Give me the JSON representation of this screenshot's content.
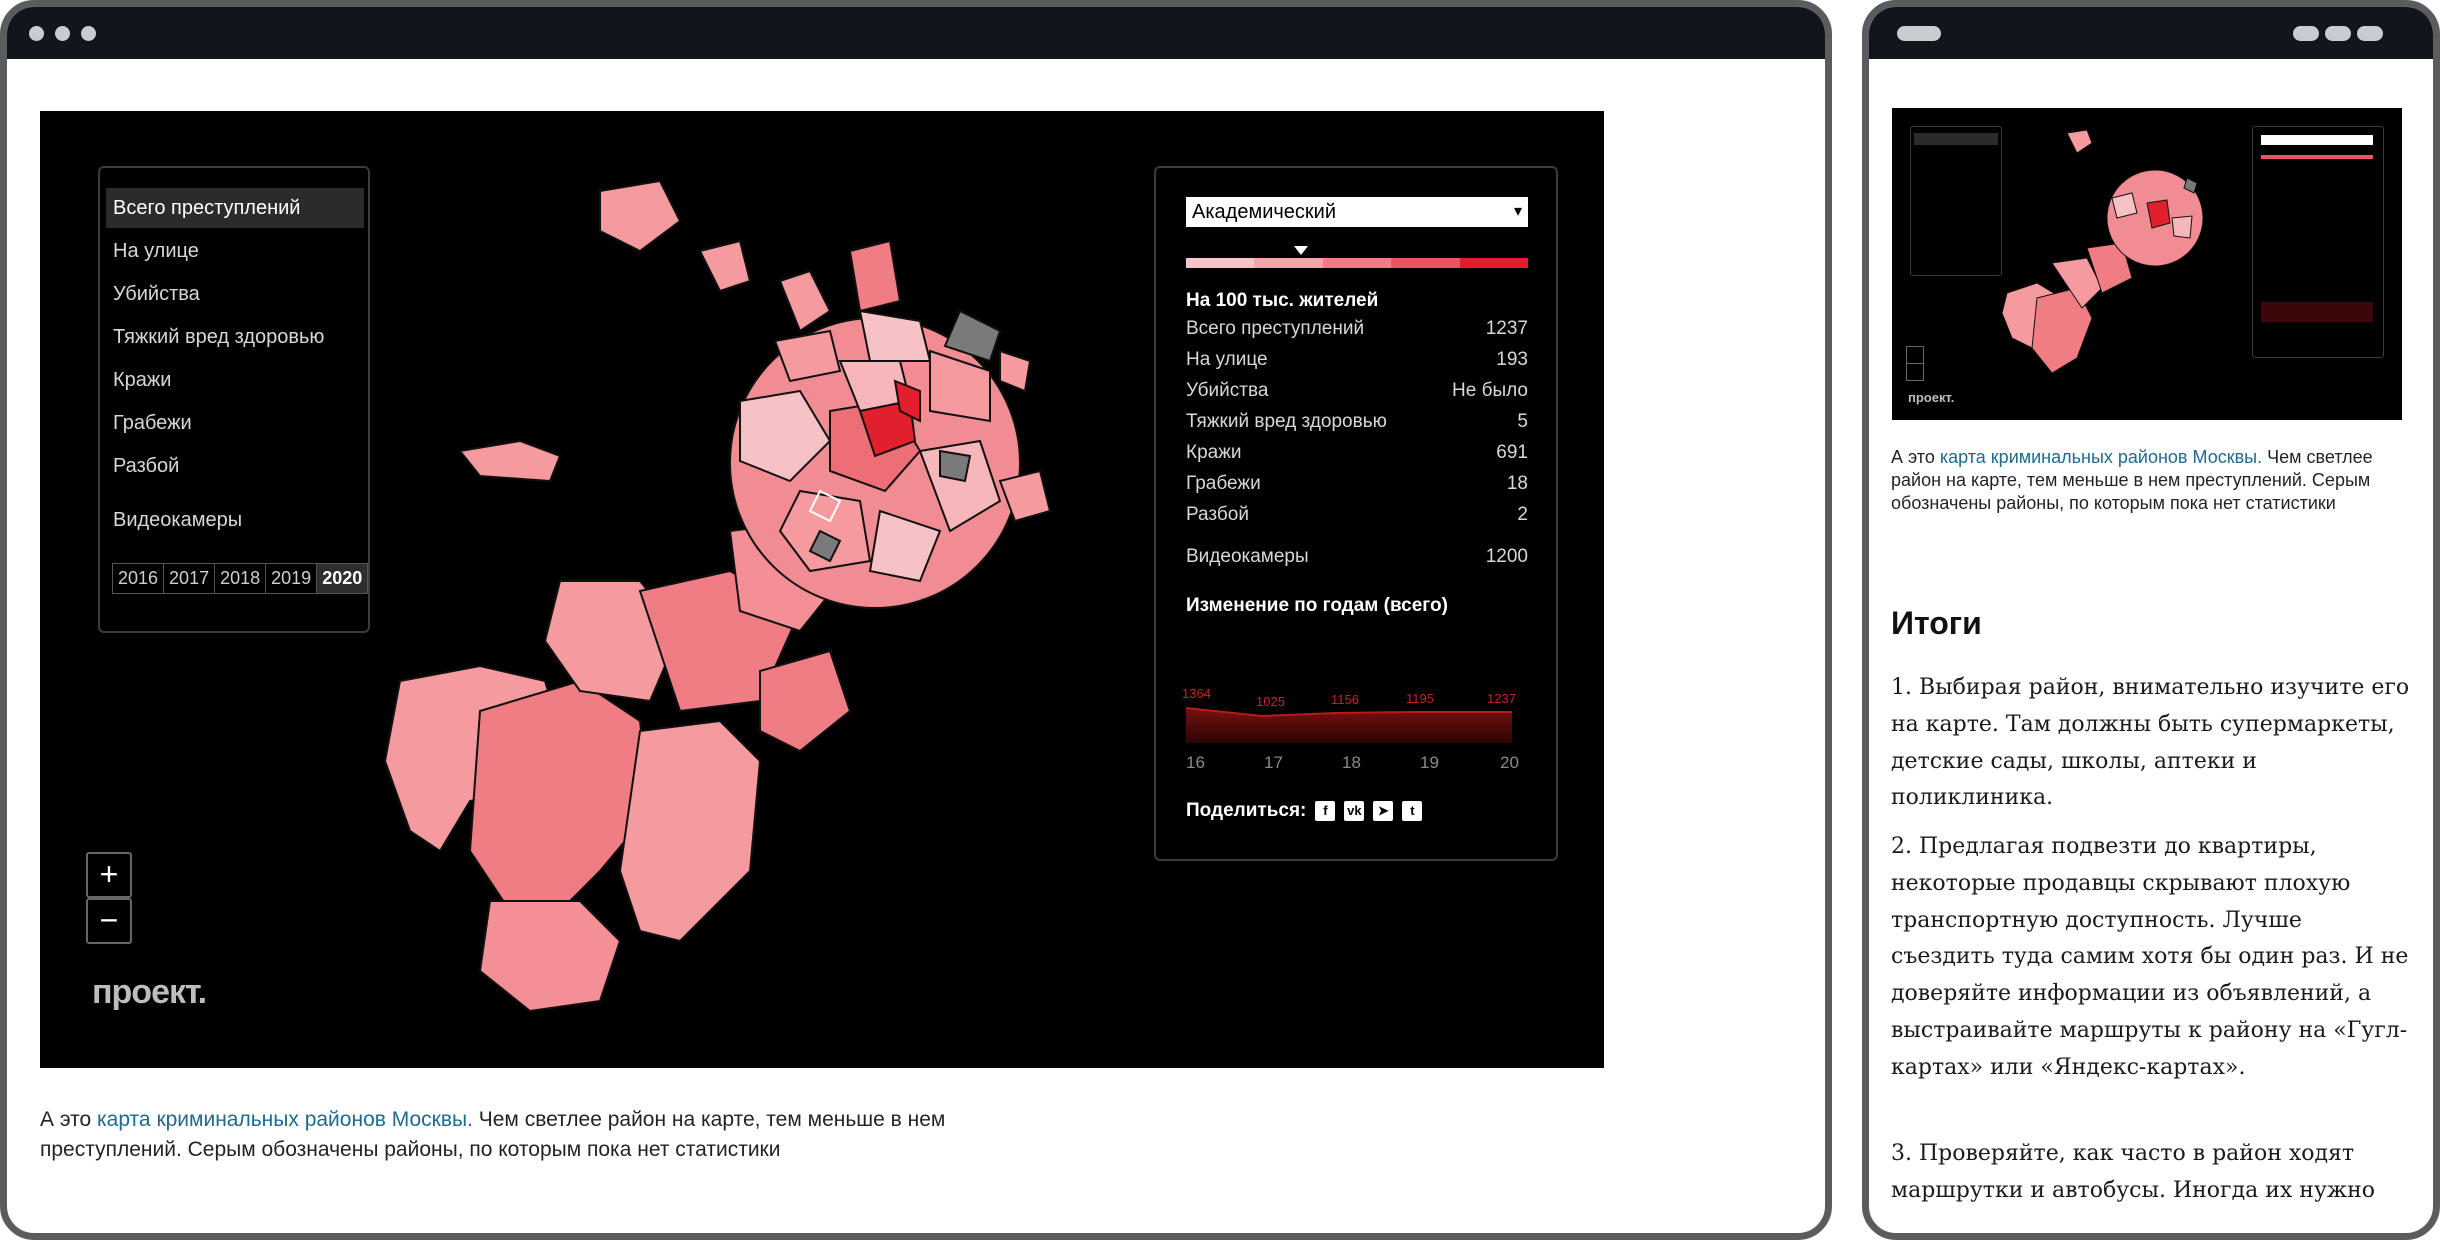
{
  "desktop_map": {
    "categories": [
      "Всего преступлений",
      "На улице",
      "Убийства",
      "Тяжкий вред здоровью",
      "Кражи",
      "Грабежи",
      "Разбой"
    ],
    "cameras_label": "Видеокамеры",
    "years": [
      "2016",
      "2017",
      "2018",
      "2019",
      "2020"
    ],
    "selected_year": "2020",
    "district": "Академический",
    "per_label": "На 100 тыс. жителей",
    "stats": [
      {
        "label": "Всего преступлений",
        "value": "1237"
      },
      {
        "label": "На улице",
        "value": "193"
      },
      {
        "label": "Убийства",
        "value": "Не было"
      },
      {
        "label": "Тяжкий вред здоровью",
        "value": "5"
      },
      {
        "label": "Кражи",
        "value": "691"
      },
      {
        "label": "Грабежи",
        "value": "18"
      },
      {
        "label": "Разбой",
        "value": "2"
      }
    ],
    "cameras_stat": {
      "label": "Видеокамеры",
      "value": "1200"
    },
    "change_title": "Изменение по годам (всего)",
    "trend_values": [
      "1364",
      "1025",
      "1156",
      "1195",
      "1237"
    ],
    "trend_ticks": [
      "16",
      "17",
      "18",
      "19",
      "20"
    ],
    "share_label": "Поделиться:",
    "share_icons": [
      "facebook-icon",
      "vk-icon",
      "telegram-icon",
      "twitter-icon"
    ],
    "zoom_in": "+",
    "zoom_out": "−",
    "logo": "проект.",
    "scale_colors": [
      "#f7c3c6",
      "#f5a3a8",
      "#f07d86",
      "#e95561",
      "#e41b2a"
    ]
  },
  "caption": {
    "prefix": "А это ",
    "link": "карта криминальных районов Москвы.",
    "rest": " Чем светлее район на карте, тем меньше в нем преступлений. Серым обозначены районы, по которым пока нет статистики"
  },
  "mobile": {
    "heading": "Итоги",
    "para1": "1. Выбирая район, внимательно изучите его на карте. Там должны быть супермаркеты, детские сады, школы, аптеки и поликлиника.",
    "para2": "2. Предлагая подвезти до квартиры, некоторые продавцы скрывают плохую транспортную доступность. Лучше съездить туда самим хотя бы один раз. И не доверяйте информации из объявлений, а выстраивайте маршруты к району на «Гугл-картах» или «Яндекс-картах».",
    "para3": "3. Проверяйте, как часто в район ходят маршрутки и автобусы. Иногда их нужно"
  }
}
